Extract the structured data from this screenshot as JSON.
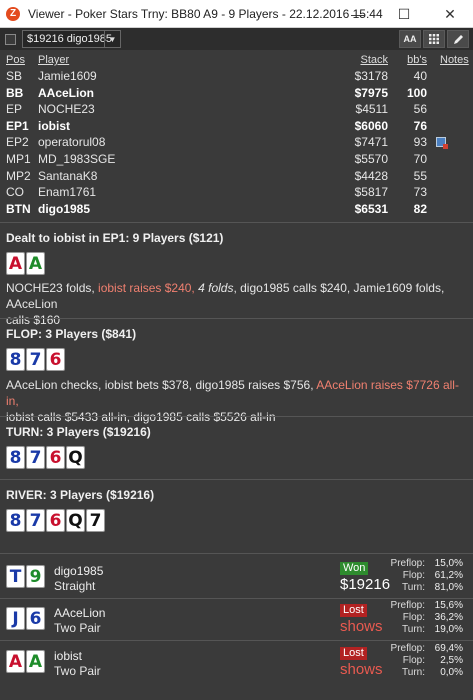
{
  "window": {
    "title": "Viewer - Poker Stars Trny: BB80 A9 - 9 Players - 22.12.2016 15:44",
    "app_icon": "Z",
    "controls": {
      "minimize": "—",
      "maximize": "☐",
      "close": "✕"
    }
  },
  "toolbar": {
    "hand_select_value": "$19216 digo1985",
    "aa_label": "AA",
    "grid_icon": "grid-icon",
    "edit_icon": "pencil-icon"
  },
  "players": {
    "headers": {
      "pos": "Pos",
      "player": "Player",
      "stack": "Stack",
      "bbs": "bb's",
      "notes": "Notes"
    },
    "rows": [
      {
        "pos": "SB",
        "name": "Jamie1609",
        "stack": "$3178",
        "bbs": "40",
        "bold": false,
        "note": false
      },
      {
        "pos": "BB",
        "name": "AAceLion",
        "stack": "$7975",
        "bbs": "100",
        "bold": true,
        "note": false
      },
      {
        "pos": "EP",
        "name": "NOCHE23",
        "stack": "$4511",
        "bbs": "56",
        "bold": false,
        "note": false
      },
      {
        "pos": "EP1",
        "name": "iobist",
        "stack": "$6060",
        "bbs": "76",
        "bold": true,
        "note": false
      },
      {
        "pos": "EP2",
        "name": "operatorul08",
        "stack": "$7471",
        "bbs": "93",
        "bold": false,
        "note": true
      },
      {
        "pos": "MP1",
        "name": "MD_1983SGE",
        "stack": "$5570",
        "bbs": "70",
        "bold": false,
        "note": false
      },
      {
        "pos": "MP2",
        "name": "SantanaK8",
        "stack": "$4428",
        "bbs": "55",
        "bold": false,
        "note": false
      },
      {
        "pos": "CO",
        "name": "Enam1761",
        "stack": "$5817",
        "bbs": "73",
        "bold": false,
        "note": false
      },
      {
        "pos": "BTN",
        "name": "digo1985",
        "stack": "$6531",
        "bbs": "82",
        "bold": true,
        "note": false
      }
    ]
  },
  "preflop": {
    "title": "Dealt to iobist in EP1: 9 Players ($121)",
    "cards": [
      {
        "rank": "A",
        "suit": "red"
      },
      {
        "rank": "A",
        "suit": "green"
      }
    ],
    "a1": "NOCHE23 folds, ",
    "a2": "iobist raises $240, ",
    "a3": "4 folds",
    "a4": ", digo1985 calls $240, Jamie1609 folds, AAceLion",
    "a5": "calls $160"
  },
  "flop": {
    "title": "FLOP: 3 Players ($841)",
    "cards": [
      {
        "rank": "8",
        "suit": "blue"
      },
      {
        "rank": "7",
        "suit": "blue"
      },
      {
        "rank": "6",
        "suit": "red"
      }
    ],
    "a1": "AAceLion checks, iobist bets $378, digo1985 raises $756, ",
    "a2": "AAceLion raises $7726 all-in,",
    "a3": "iobist calls $5433 all-in, digo1985 calls $5526 all-in"
  },
  "turn": {
    "title": "TURN: 3 Players ($19216)",
    "cards": [
      {
        "rank": "8",
        "suit": "blue"
      },
      {
        "rank": "7",
        "suit": "blue"
      },
      {
        "rank": "6",
        "suit": "red"
      },
      {
        "rank": "Q",
        "suit": "black"
      }
    ]
  },
  "river": {
    "title": "RIVER: 3 Players ($19216)",
    "cards": [
      {
        "rank": "8",
        "suit": "blue"
      },
      {
        "rank": "7",
        "suit": "blue"
      },
      {
        "rank": "6",
        "suit": "red"
      },
      {
        "rank": "Q",
        "suit": "black"
      },
      {
        "rank": "7",
        "suit": "black"
      }
    ]
  },
  "results": [
    {
      "cards": [
        {
          "rank": "T",
          "suit": "blue"
        },
        {
          "rank": "9",
          "suit": "green"
        }
      ],
      "name": "digo1985",
      "hand": "Straight",
      "status": "Won",
      "amount": "$19216",
      "stats": {
        "preflop_label": "Preflop:",
        "preflop": "15,0%",
        "flop_label": "Flop:",
        "flop": "61,2%",
        "turn_label": "Turn:",
        "turn": "81,0%"
      }
    },
    {
      "cards": [
        {
          "rank": "J",
          "suit": "blue"
        },
        {
          "rank": "6",
          "suit": "blue"
        }
      ],
      "name": "AAceLion",
      "hand": "Two Pair",
      "status": "Lost",
      "amount": "shows",
      "stats": {
        "preflop_label": "Preflop:",
        "preflop": "15,6%",
        "flop_label": "Flop:",
        "flop": "36,2%",
        "turn_label": "Turn:",
        "turn": "19,0%"
      }
    },
    {
      "cards": [
        {
          "rank": "A",
          "suit": "red"
        },
        {
          "rank": "A",
          "suit": "green"
        }
      ],
      "name": "iobist",
      "hand": "Two Pair",
      "status": "Lost",
      "amount": "shows",
      "stats": {
        "preflop_label": "Preflop:",
        "preflop": "69,4%",
        "flop_label": "Flop:",
        "flop": "2,5%",
        "turn_label": "Turn:",
        "turn": "0,0%"
      }
    }
  ]
}
